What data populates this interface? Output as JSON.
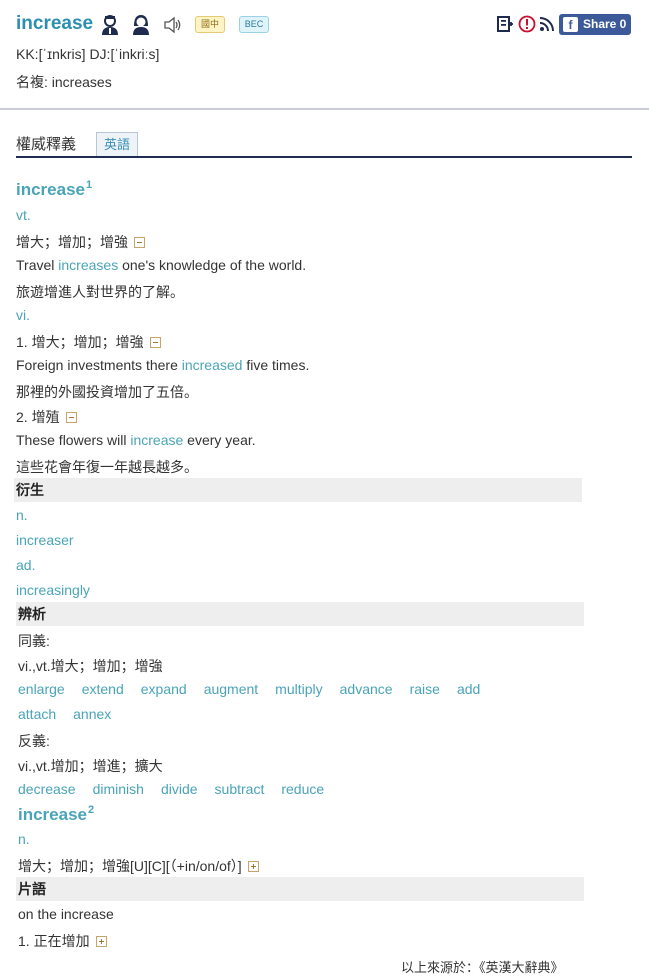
{
  "header": {
    "headword": "increase",
    "tag_cn": "國中",
    "tag_bec": "BEC",
    "share_label": "Share 0",
    "pronunciation": "KK:[ˈɪnkris] DJ:[ˈinkriːs]",
    "plural": "名複: increases"
  },
  "tabs": {
    "title": "權威釋義",
    "active": "英語"
  },
  "entry1": {
    "word": "increase",
    "sup": "1",
    "pos_vt": "vt.",
    "vt_def": "增大；增加；增強",
    "vt_ex_pre": "Travel ",
    "vt_ex_key": "increases",
    "vt_ex_post": " one's knowledge of the world.",
    "vt_ex_tr": "旅遊增進人對世界的了解。",
    "pos_vi": "vi.",
    "vi_def1": "1. 增大；增加；增強",
    "vi_ex1_pre": "Foreign investments there ",
    "vi_ex1_key": "increased",
    "vi_ex1_post": " five times.",
    "vi_ex1_tr": "那裡的外國投資增加了五倍。",
    "vi_def2": "2. 增殖",
    "vi_ex2_pre": "These flowers will ",
    "vi_ex2_key": "increase",
    "vi_ex2_post": " every year.",
    "vi_ex2_tr": "這些花會年復一年越長越多。"
  },
  "derived": {
    "title": "衍生",
    "pos_n": "n.",
    "word_n": "increaser",
    "pos_ad": "ad.",
    "word_ad": "increasingly"
  },
  "analysis": {
    "title": "辨析",
    "syn_label": "同義:",
    "syn_def": "vi.,vt.增大；增加；增強",
    "syn_words_row1": [
      "enlarge",
      "extend",
      "expand",
      "augment",
      "multiply",
      "advance",
      "raise",
      "add"
    ],
    "syn_words_row2": [
      "attach",
      "annex"
    ],
    "ant_label": "反義:",
    "ant_def": "vi.,vt.增加；增進；擴大",
    "ant_words": [
      "decrease",
      "diminish",
      "divide",
      "subtract",
      "reduce"
    ]
  },
  "entry2": {
    "word": "increase",
    "sup": "2",
    "pos_n": "n.",
    "def": "增大；增加；增強[U][C][（+in/on/of）]"
  },
  "phrases": {
    "title": "片語",
    "phrase": "on the increase",
    "def": "1. 正在增加"
  },
  "source": "以上來源於：《英漢大辭典》",
  "colors": {
    "accent": "#4aa4b8",
    "headword": "#2d8fb0",
    "tab_rule": "#1f2d55",
    "share_bg": "#3c5a99"
  }
}
